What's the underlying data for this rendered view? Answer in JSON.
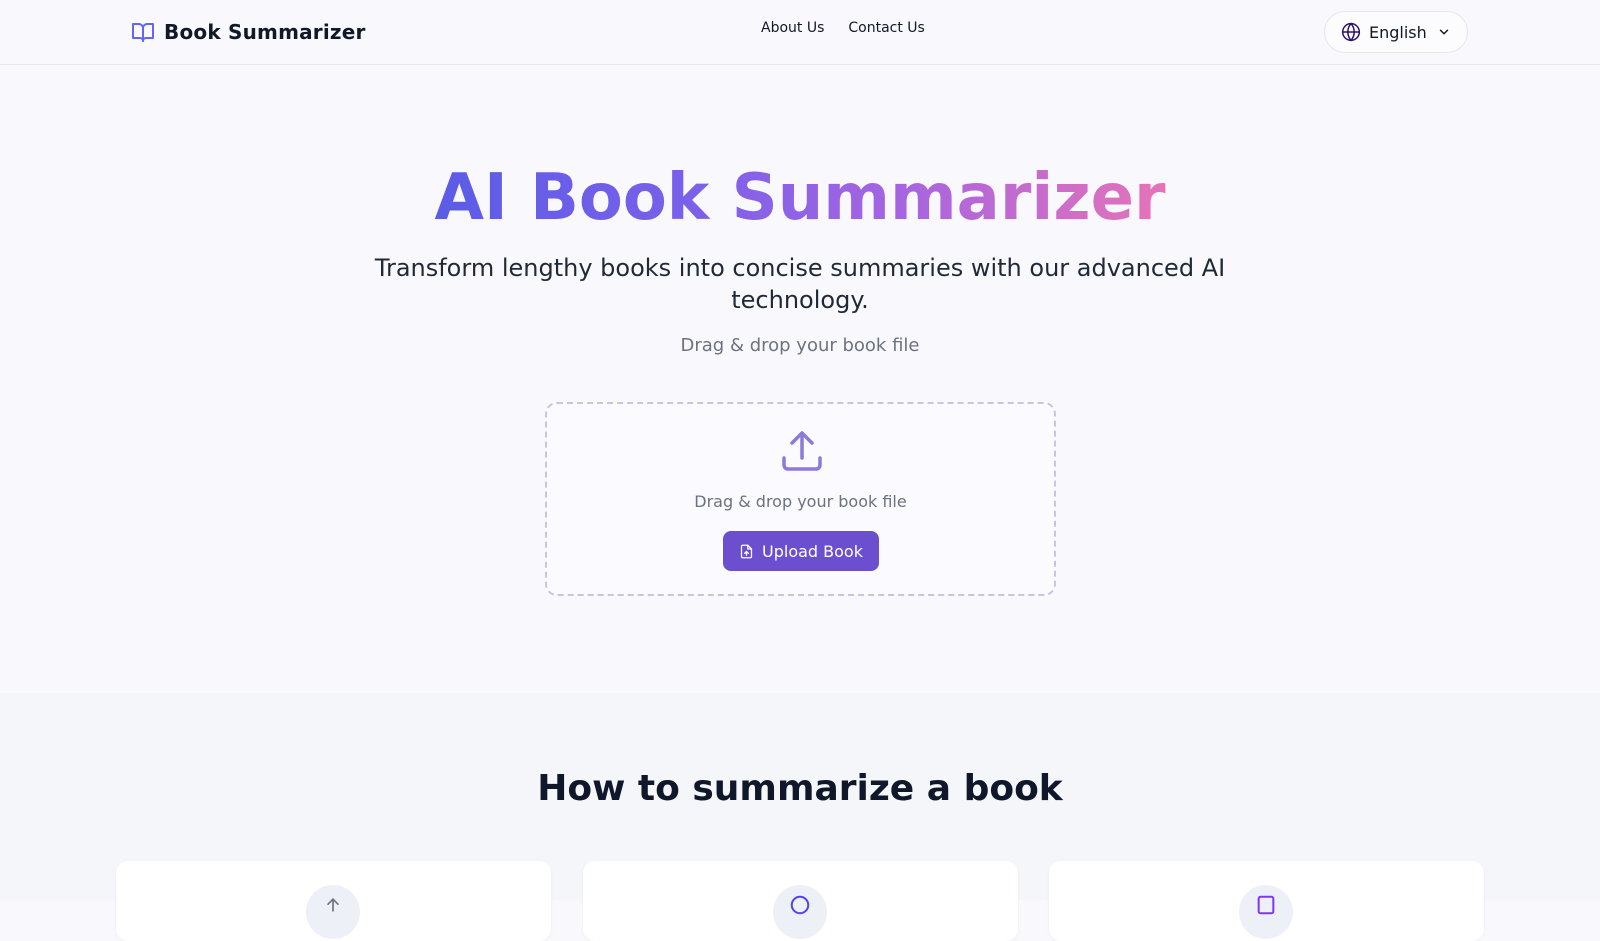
{
  "header": {
    "brand": "Book Summarizer",
    "brand_icon": "book-open-icon",
    "nav": [
      {
        "label": "About Us"
      },
      {
        "label": "Contact Us"
      }
    ],
    "language": {
      "label": "English",
      "icon": "globe-icon",
      "chevron": "chevron-down-icon"
    }
  },
  "hero": {
    "title": "AI Book Summarizer",
    "subtitle": "Transform lengthy books into concise summaries with our advanced AI technology.",
    "hint": "Drag & drop your book file",
    "dropzone": {
      "icon": "upload-icon",
      "text": "Drag & drop your book file",
      "button_label": "Upload Book",
      "button_icon": "file-upload-icon"
    }
  },
  "how_to": {
    "title": "How to summarize a book",
    "cards": [
      {
        "icon": "upload-icon"
      },
      {
        "icon": "ai-icon"
      },
      {
        "icon": "document-icon"
      }
    ]
  },
  "colors": {
    "accent": "#6b4fcf",
    "gradient_start": "#5b5ce6",
    "gradient_end": "#e673b8",
    "brand_icon": "#6366f1"
  }
}
